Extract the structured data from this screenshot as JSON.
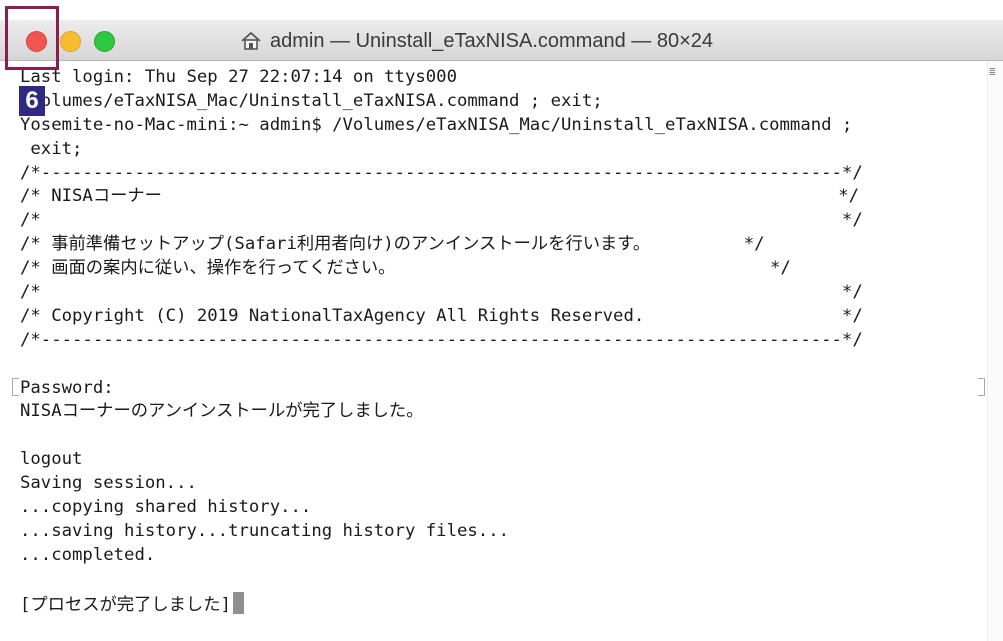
{
  "window": {
    "title": "admin — Uninstall_eTaxNISA.command — 80×24"
  },
  "annotation": {
    "badge": "6"
  },
  "terminal": {
    "lines": [
      "Last login: Thu Sep 27 22:07:14 on ttys000",
      "/Volumes/eTaxNISA_Mac/Uninstall_eTaxNISA.command ; exit;",
      "Yosemite-no-Mac-mini:~ admin$ /Volumes/eTaxNISA_Mac/Uninstall_eTaxNISA.command ;",
      " exit;",
      "/*-----------------------------------------------------------------------------*/",
      "/* NISAコーナー                                                                 */",
      "/*                                                                             */",
      "/* 事前準備セットアップ(Safari利用者向け)のアンインストールを行います。         */",
      "/* 画面の案内に従い、操作を行ってください。                                    */",
      "/*                                                                             */",
      "/* Copyright (C) 2019 NationalTaxAgency All Rights Reserved.                   */",
      "/*-----------------------------------------------------------------------------*/",
      "",
      "Password:",
      "NISAコーナーのアンインストールが完了しました。",
      "",
      "logout",
      "Saving session...",
      "...copying shared history...",
      "...saving history...truncating history files...",
      "...completed.",
      "",
      "[プロセスが完了しました]"
    ]
  }
}
